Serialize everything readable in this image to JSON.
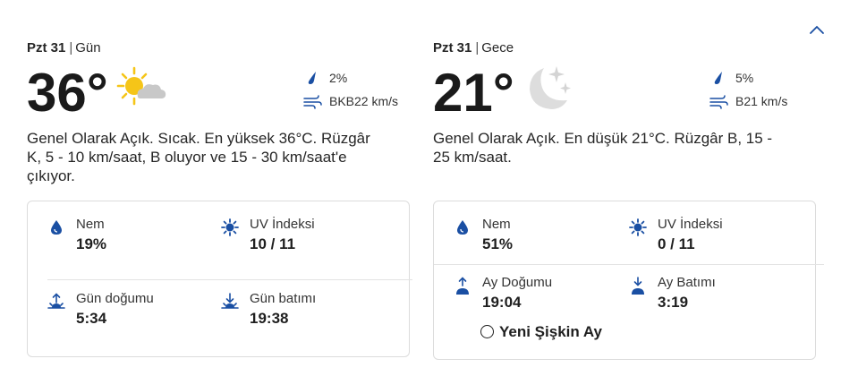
{
  "day": {
    "date": "Pzt 31",
    "period": "Gün",
    "temperature": "36°",
    "weather_icon": "sun-cloud-icon",
    "precipitation": "2%",
    "wind": "BKB22 km/s",
    "description": "Genel Olarak Açık. Sıcak. En yüksek 36°C. Rüzgâr K, 5 - 10 km/saat, B oluyor ve 15 - 30 km/saat'e çıkıyor.",
    "details": {
      "humidity_label": "Nem",
      "humidity_value": "19%",
      "uv_label": "UV İndeksi",
      "uv_value": "10 / 11",
      "sunrise_label": "Gün doğumu",
      "sunrise_value": "5:34",
      "sunset_label": "Gün batımı",
      "sunset_value": "19:38"
    }
  },
  "night": {
    "date": "Pzt 31",
    "period": "Gece",
    "temperature": "21°",
    "weather_icon": "moon-stars-icon",
    "precipitation": "5%",
    "wind": "B21 km/s",
    "description": "Genel Olarak Açık. En düşük 21°C. Rüzgâr B, 15 - 25 km/saat.",
    "details": {
      "humidity_label": "Nem",
      "humidity_value": "51%",
      "uv_label": "UV İndeksi",
      "uv_value": "0 / 11",
      "moonrise_label": "Ay Doğumu",
      "moonrise_value": "19:04",
      "moonset_label": "Ay Batımı",
      "moonset_value": "3:19",
      "moon_phase": "Yeni Şişkin Ay"
    }
  },
  "colors": {
    "accent_blue": "#1a4fa3",
    "sun_yellow": "#f5c518",
    "cloud_gray": "#c8c8c8",
    "moon_gray": "#d9d9d9"
  }
}
